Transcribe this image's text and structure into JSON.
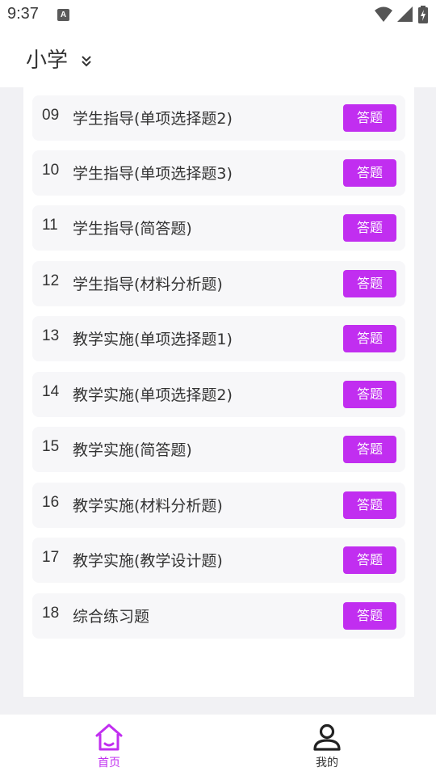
{
  "status_bar": {
    "time": "9:37",
    "notification_icon": "A"
  },
  "header": {
    "title": "小学"
  },
  "items": [
    {
      "num": "09",
      "title": "学生指导(单项选择题2)",
      "button": "答题"
    },
    {
      "num": "10",
      "title": "学生指导(单项选择题3)",
      "button": "答题"
    },
    {
      "num": "11",
      "title": "学生指导(简答题)",
      "button": "答题"
    },
    {
      "num": "12",
      "title": "学生指导(材料分析题)",
      "button": "答题"
    },
    {
      "num": "13",
      "title": "教学实施(单项选择题1)",
      "button": "答题"
    },
    {
      "num": "14",
      "title": "教学实施(单项选择题2)",
      "button": "答题"
    },
    {
      "num": "15",
      "title": "教学实施(简答题)",
      "button": "答题"
    },
    {
      "num": "16",
      "title": "教学实施(材料分析题)",
      "button": "答题"
    },
    {
      "num": "17",
      "title": "教学实施(教学设计题)",
      "button": "答题"
    },
    {
      "num": "18",
      "title": "综合练习题",
      "button": "答题"
    }
  ],
  "bottom_nav": {
    "home_label": "首页",
    "mine_label": "我的"
  },
  "colors": {
    "accent": "#c12ef0",
    "row_background": "#f7f7f9",
    "page_background": "#f1f1f4"
  }
}
